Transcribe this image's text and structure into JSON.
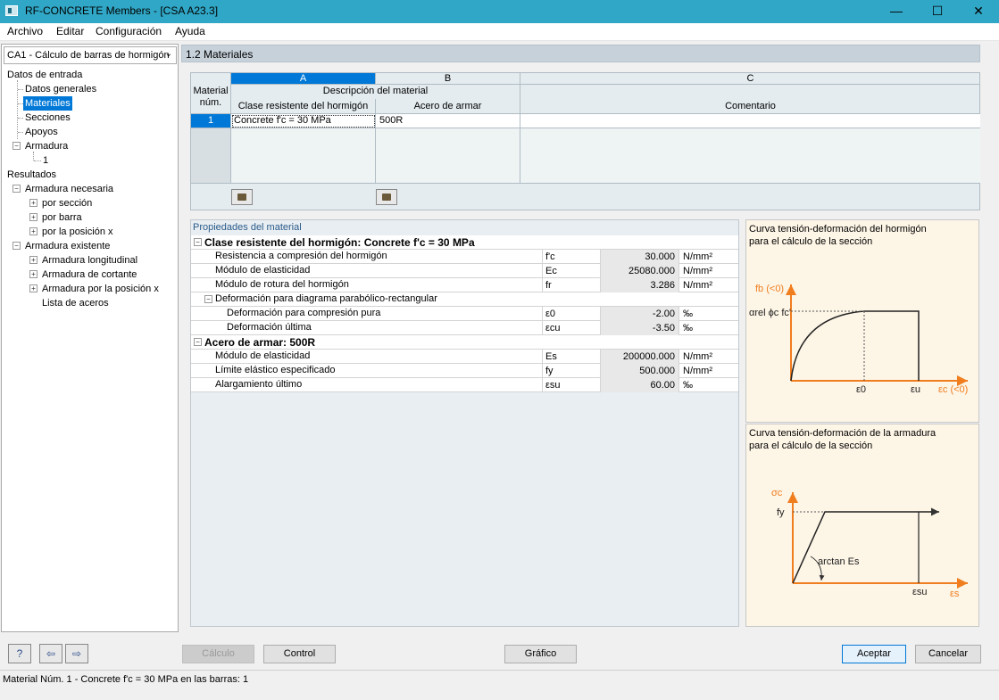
{
  "window": {
    "title": "RF-CONCRETE Members - [CSA A23.3]",
    "minimize": "—",
    "maximize": "☐",
    "close": "✕"
  },
  "menu": [
    "Archivo",
    "Editar",
    "Configuración",
    "Ayuda"
  ],
  "case_selector": "CA1 - Cálculo de barras de hormigón",
  "tree": {
    "input_header": "Datos de entrada",
    "input_items": [
      "Datos generales",
      "Materiales",
      "Secciones",
      "Apoyos",
      "Armadura"
    ],
    "armadura_child": "1",
    "results_header": "Resultados",
    "necesaria": "Armadura necesaria",
    "necesaria_items": [
      "por sección",
      "por barra",
      "por la posición x"
    ],
    "existente": "Armadura existente",
    "existente_items": [
      "Armadura longitudinal",
      "Armadura de cortante",
      "Armadura por la posición x",
      "Lista de aceros"
    ]
  },
  "section_title": "1.2 Materiales",
  "table": {
    "col_letters": [
      "A",
      "B",
      "C"
    ],
    "material_num_header": [
      "Material",
      "núm."
    ],
    "desc_header": "Descripción del material",
    "col_a": "Clase resistente del hormigón",
    "col_b": "Acero de armar",
    "col_c": "Comentario",
    "rows": [
      {
        "num": "1",
        "concrete": "Concrete f'c = 30 MPa",
        "steel": "500R",
        "comment": ""
      }
    ]
  },
  "props": {
    "title": "Propiedades del material",
    "concrete_group": "Clase resistente del hormigón: Concrete f'c = 30 MPa",
    "concrete_rows": [
      {
        "name": "Resistencia a compresión del hormigón",
        "sym": "f'c",
        "value": "30.000",
        "unit": "N/mm²"
      },
      {
        "name": "Módulo de elasticidad",
        "sym": "Ec",
        "value": "25080.000",
        "unit": "N/mm²"
      },
      {
        "name": "Módulo de rotura del hormigón",
        "sym": "fr",
        "value": "3.286",
        "unit": "N/mm²"
      }
    ],
    "deform_group": "Deformación para diagrama parabólico-rectangular",
    "deform_rows": [
      {
        "name": "Deformación para compresión pura",
        "sym": "ε0",
        "value": "-2.00",
        "unit": "‰"
      },
      {
        "name": "Deformación última",
        "sym": "εcu",
        "value": "-3.50",
        "unit": "‰"
      }
    ],
    "steel_group": "Acero de armar: 500R",
    "steel_rows": [
      {
        "name": "Módulo de elasticidad",
        "sym": "Es",
        "value": "200000.000",
        "unit": "N/mm²"
      },
      {
        "name": "Límite elástico especificado",
        "sym": "fy",
        "value": "500.000",
        "unit": "N/mm²"
      },
      {
        "name": "Alargamiento último",
        "sym": "εsu",
        "value": "60.00",
        "unit": "‰"
      }
    ]
  },
  "figure_concrete": {
    "title": [
      "Curva tensión-deformación del hormigón",
      "para el cálculo de la sección"
    ],
    "y_label": "fb (<0)",
    "level_label": "αrel ϕc fc'",
    "x0": "ε0",
    "xu": "εu",
    "x_label": "εc (<0)"
  },
  "figure_steel": {
    "title": [
      "Curva tensión-deformación de la armadura",
      "para el cálculo de la sección"
    ],
    "y_label": "σc",
    "fy": "fy",
    "slope": "arctan Es",
    "esu": "εsu",
    "x_label": "εs"
  },
  "buttons": {
    "calc": "Cálculo",
    "control": "Control",
    "graph": "Gráfico",
    "ok": "Aceptar",
    "cancel": "Cancelar"
  },
  "icons": {
    "help": "?",
    "back": "⇦",
    "forward": "⇨"
  },
  "status": "Material Núm. 1  -  Concrete f'c = 30 MPa en las barras: 1",
  "colors": {
    "title_bar": "#30a7c6",
    "selection": "#0078d7",
    "axis_orange": "#f07d1e",
    "figure_bg": "#fdf5e6"
  }
}
